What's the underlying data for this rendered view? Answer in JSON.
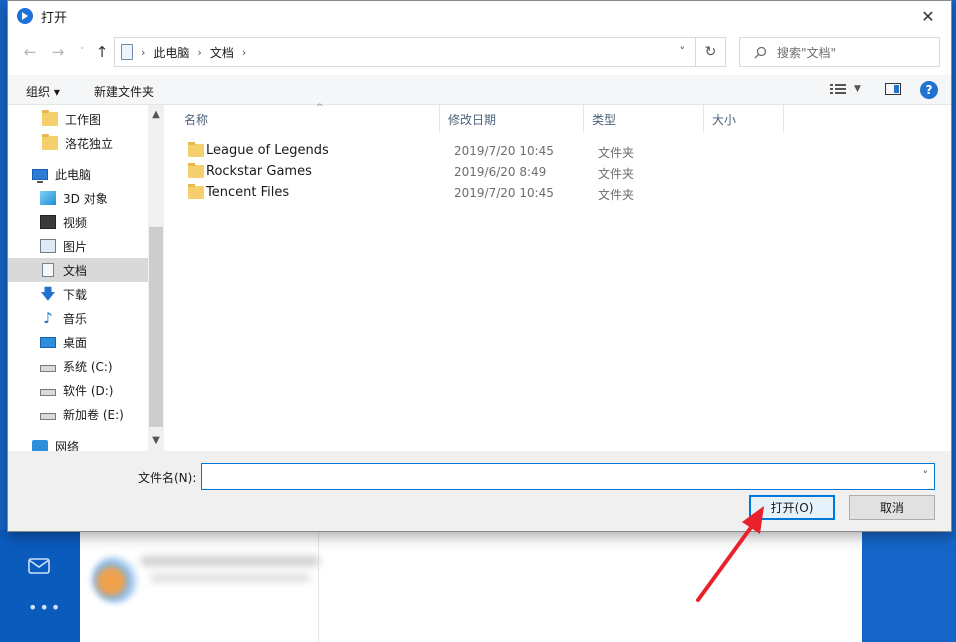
{
  "dialog": {
    "title": "打开",
    "close_glyph": "✕"
  },
  "navbar": {
    "breadcrumb": [
      "此电脑",
      "文档"
    ],
    "search_placeholder": "搜索\"文档\""
  },
  "toolbar": {
    "organize_label": "组织 ▾",
    "new_folder_label": "新建文件夹"
  },
  "sidebar": {
    "items": [
      {
        "label": "工作图",
        "icon": "folder-icon"
      },
      {
        "label": "洛花独立",
        "icon": "folder-icon"
      },
      {
        "label": "此电脑",
        "icon": "computer-icon"
      },
      {
        "label": "3D 对象",
        "icon": "cube-icon"
      },
      {
        "label": "视频",
        "icon": "video-icon"
      },
      {
        "label": "图片",
        "icon": "picture-icon"
      },
      {
        "label": "文档",
        "icon": "document-icon",
        "selected": true
      },
      {
        "label": "下载",
        "icon": "download-icon"
      },
      {
        "label": "音乐",
        "icon": "music-icon"
      },
      {
        "label": "桌面",
        "icon": "desktop-icon"
      },
      {
        "label": "系统 (C:)",
        "icon": "drive-icon"
      },
      {
        "label": "软件 (D:)",
        "icon": "drive-icon"
      },
      {
        "label": "新加卷 (E:)",
        "icon": "drive-icon"
      },
      {
        "label": "网络",
        "icon": "network-icon"
      }
    ]
  },
  "filelist": {
    "columns": [
      "名称",
      "修改日期",
      "类型",
      "大小"
    ],
    "rows": [
      {
        "name": "League of Legends",
        "date": "2019/7/20 10:45",
        "type": "文件夹"
      },
      {
        "name": "Rockstar Games",
        "date": "2019/6/20 8:49",
        "type": "文件夹"
      },
      {
        "name": "Tencent Files",
        "date": "2019/7/20 10:45",
        "type": "文件夹"
      }
    ]
  },
  "bottom": {
    "filename_label": "文件名(N):",
    "filename_value": "",
    "open_label": "打开(O)",
    "cancel_label": "取消"
  },
  "colors": {
    "accent": "#0078d7",
    "folder": "#f5cf6b",
    "annotation": "#e8212a"
  }
}
